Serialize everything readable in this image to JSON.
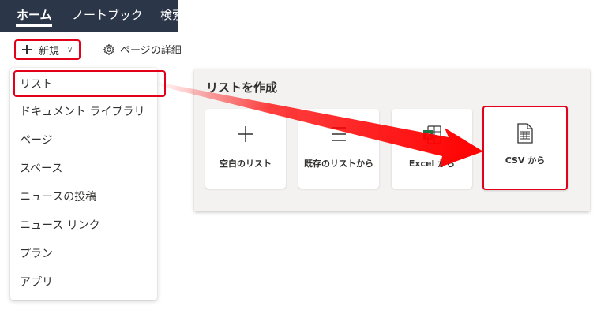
{
  "topnav": {
    "items": [
      "ホーム",
      "ノートブック",
      "検索"
    ]
  },
  "commandbar": {
    "new_label": "新規",
    "page_details_label": "ページの詳細"
  },
  "new_menu": {
    "items": [
      "リスト",
      "ドキュメント ライブラリ",
      "ページ",
      "スペース",
      "ニュースの投稿",
      "ニュース リンク",
      "プラン",
      "アプリ"
    ]
  },
  "create_list": {
    "title": "リストを作成",
    "cards": [
      "空白のリスト",
      "既存のリストから",
      "Excel から",
      "CSV から"
    ]
  },
  "colors": {
    "topbar_bg": "#2b3648",
    "highlight_red": "#e3001b",
    "excel_green": "#217346"
  },
  "icons": [
    "plus-icon",
    "chevron-down-icon",
    "gear-icon",
    "list-icon",
    "excel-icon",
    "csv-icon",
    "arrow-annotation"
  ]
}
